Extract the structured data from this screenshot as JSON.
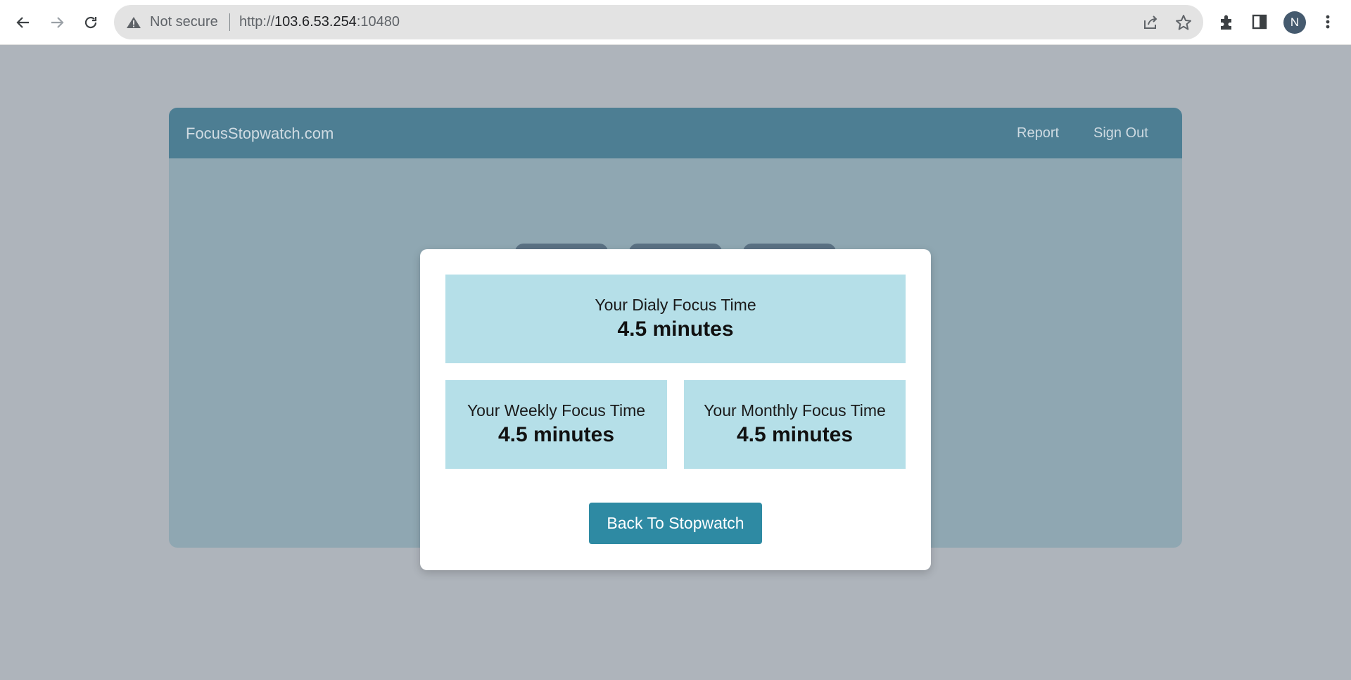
{
  "browser": {
    "security_label": "Not secure",
    "url_scheme": "http://",
    "url_host": "103.6.53.254",
    "url_port": ":10480",
    "profile_initial": "N"
  },
  "app": {
    "brand": "FocusStopwatch.com",
    "nav": {
      "report": "Report",
      "sign_out": "Sign Out"
    }
  },
  "modal": {
    "daily": {
      "label": "Your Dialy Focus Time",
      "value": "4.5 minutes"
    },
    "weekly": {
      "label": "Your Weekly Focus Time",
      "value": "4.5 minutes"
    },
    "monthly": {
      "label": "Your Monthly Focus Time",
      "value": "4.5 minutes"
    },
    "back_button": "Back To Stopwatch"
  },
  "colors": {
    "header": "#4d7e93",
    "stat_box": "#b5dfe8",
    "button": "#2e8aa3",
    "overlay": "#aeb4bb"
  }
}
